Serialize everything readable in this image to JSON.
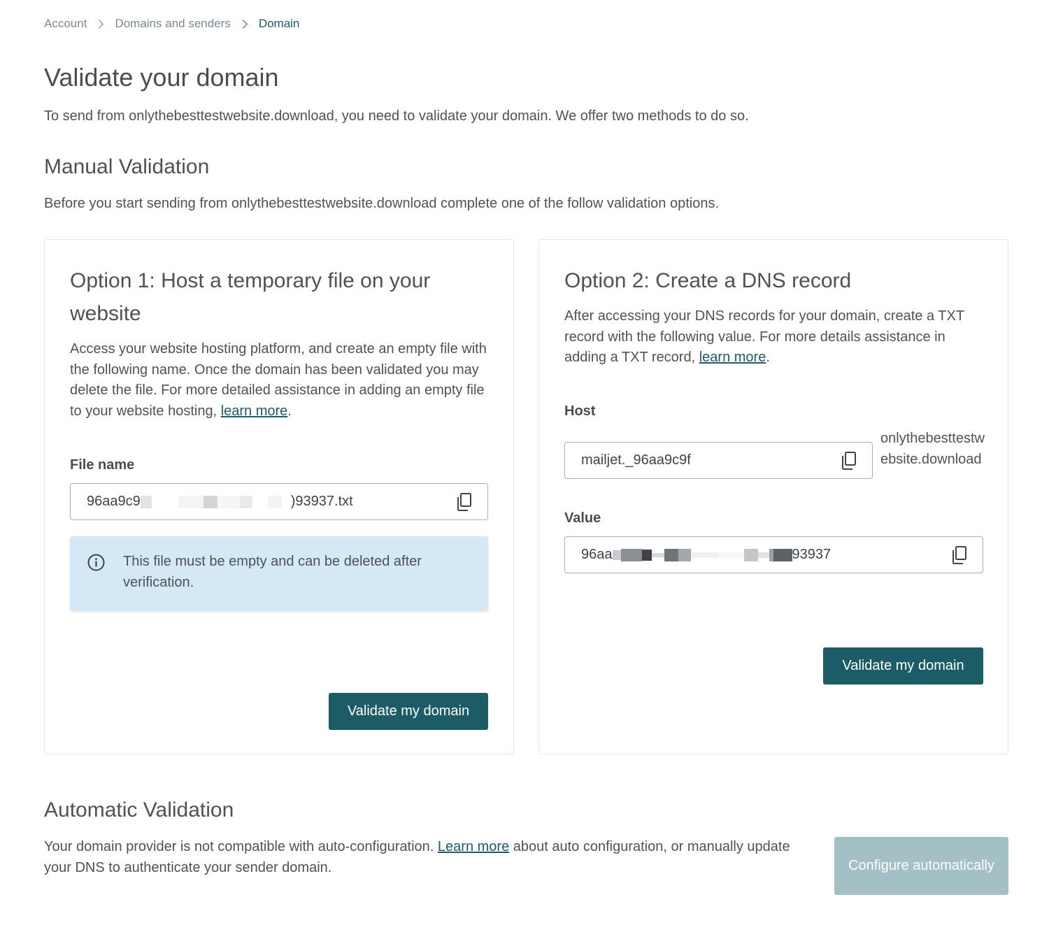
{
  "breadcrumb": {
    "items": [
      "Account",
      "Domains and senders",
      "Domain"
    ]
  },
  "page": {
    "title": "Validate your domain",
    "intro": "To send from onlythebesttestwebsite.download, you need to validate your domain. We offer two methods to do so."
  },
  "manual": {
    "title": "Manual Validation",
    "description": "Before you start sending from onlythebesttestwebsite.download complete one of the follow validation options."
  },
  "option1": {
    "title": "Option 1: Host a temporary file on your website",
    "description_before": "Access your website hosting platform, and create an empty file with the following name. Once the domain has been validated you may delete the file. For more detailed assistance in adding an empty file to your website hosting, ",
    "link": "learn more",
    "description_after": ".",
    "file_label": "File name",
    "file_value_start": "96aa9c9",
    "file_value_end": ")93937.txt",
    "notice": "This file must be empty and can be deleted after verification.",
    "button": "Validate my domain"
  },
  "option2": {
    "title": "Option 2: Create a DNS record",
    "description_before": "After accessing your DNS records for your domain, create a TXT record with the following value. For more details assistance in adding a TXT record, ",
    "link": "learn more",
    "description_after": ".",
    "host_label": "Host",
    "host_value": "mailjet._96aa9c9f",
    "host_domain": "onlythebesttestwebsite.download",
    "value_label": "Value",
    "value_start": "96aa",
    "value_end": "93937",
    "button": "Validate my domain"
  },
  "automatic": {
    "title": "Automatic Validation",
    "description_before": "Your domain provider is not compatible with auto-configuration. ",
    "link": "Learn more",
    "description_after": " about auto configuration, or manually update your DNS to authenticate your sender domain.",
    "button": "Configure automatically"
  },
  "icons": {
    "copy": "copy-icon",
    "info": "info-icon",
    "chevron": "chevron-right-icon"
  },
  "colors": {
    "primary": "#1b5c67",
    "disabled": "#a3c0c5",
    "notice_bg": "#d5e8f6"
  }
}
